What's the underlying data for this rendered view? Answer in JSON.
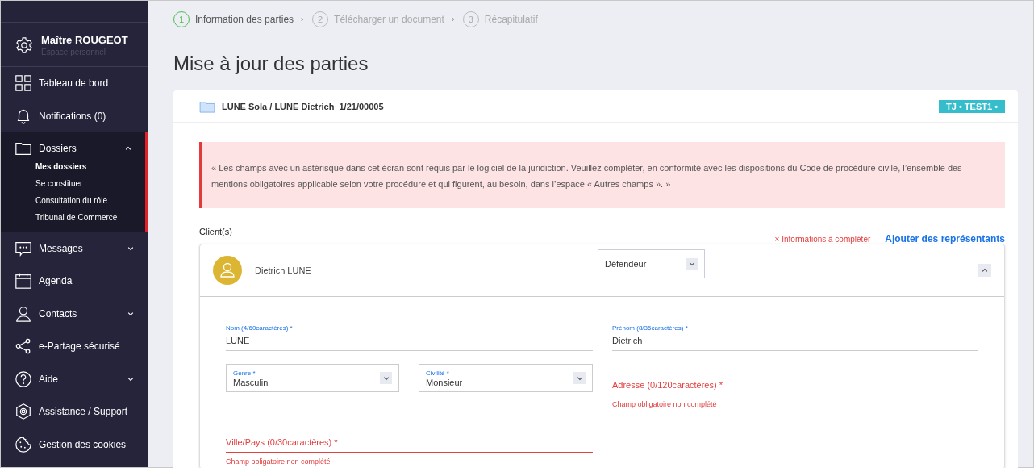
{
  "sidebar": {
    "user": {
      "name": "Maître ROUGEOT",
      "subtitle": "Espace personnel"
    },
    "items": [
      {
        "label": "Tableau de bord",
        "kind": "link",
        "selected": false
      },
      {
        "label": "Notifications (0)",
        "kind": "link",
        "selected": false
      },
      {
        "label": "Dossiers",
        "kind": "group",
        "expanded": true,
        "selected": true,
        "children": [
          {
            "label": "Mes dossiers",
            "selected": true
          },
          {
            "label": "Se constituer",
            "selected": false
          },
          {
            "label": "Consultation du rôle",
            "selected": false
          },
          {
            "label": "Tribunal de Commerce",
            "selected": false
          }
        ]
      },
      {
        "label": "Messages",
        "kind": "group",
        "expanded": false,
        "selected": false
      },
      {
        "label": "Agenda",
        "kind": "link",
        "selected": false
      },
      {
        "label": "Contacts",
        "kind": "group",
        "expanded": false,
        "selected": false
      },
      {
        "label": "e-Partage sécurisé",
        "kind": "link",
        "selected": false
      },
      {
        "label": "Aide",
        "kind": "group",
        "expanded": false,
        "selected": false
      },
      {
        "label": "Assistance / Support",
        "kind": "link",
        "selected": false
      },
      {
        "label": "Gestion des cookies",
        "kind": "link",
        "selected": false
      }
    ]
  },
  "steps": [
    {
      "number": "1",
      "label": "Information des parties",
      "selected": true
    },
    {
      "number": "2",
      "label": "Télécharger un document",
      "selected": false
    },
    {
      "number": "3",
      "label": "Récapitulatif",
      "selected": false
    }
  ],
  "title": "Mise à jour des parties",
  "case": {
    "name": "LUNE Sola / LUNE Dietrich_1/21/00005",
    "badge": "TJ • TEST1 •"
  },
  "alert": "« Les champs avec un astérisque dans cet écran sont requis par le logiciel de la juridiction. Veuillez compléter, en conformité avec les dispositions du Code de procédure civile, l’ensemble des mentions obligatoires applicable selon votre procédure et qui figurent, au besoin, dans l’espace « Autres champs ». »",
  "clients": {
    "label": "Client(s)",
    "warning": "× Informations à compléter",
    "add_link": "Ajouter des représentants",
    "client": {
      "name": "Dietrich LUNE",
      "role": "Défendeur",
      "expanded": true,
      "fields": [
        {
          "kind": "text",
          "label": "Nom (4/60caractères) *",
          "value": "LUNE",
          "invalid": false
        },
        {
          "kind": "text",
          "label": "Prénom (8/35caractères) *",
          "value": "Dietrich",
          "invalid": false
        },
        {
          "kind": "select",
          "label": "Genre *",
          "value": "Masculin",
          "invalid": false
        },
        {
          "kind": "select",
          "label": "Civilité *",
          "value": "Monsieur",
          "invalid": false
        },
        {
          "kind": "text",
          "label": "Adresse (0/120caractères) *",
          "invalid": true,
          "error": "Champ obligatoire non complété"
        },
        {
          "kind": "text",
          "label": "Ville/Pays (0/30caractères) *",
          "invalid": true,
          "error": "Champ obligatoire non complété"
        }
      ]
    }
  }
}
